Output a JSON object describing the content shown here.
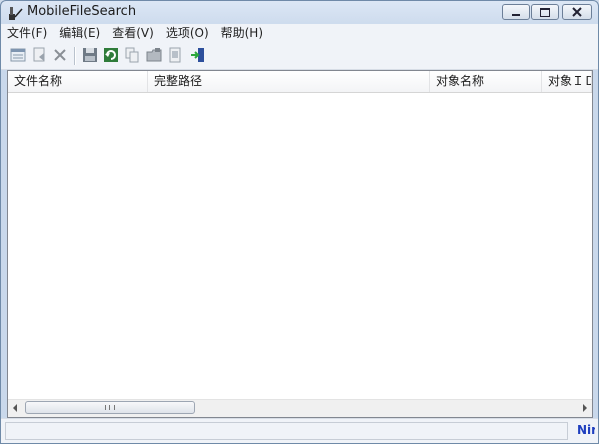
{
  "window": {
    "title": "MobileFileSearch"
  },
  "menu": [
    "文件(F)",
    "编辑(E)",
    "查看(V)",
    "选项(O)",
    "帮助(H)"
  ],
  "toolbar_icons": [
    "properties-icon",
    "open-icon",
    "delete-icon",
    "save-icon",
    "refresh-icon",
    "copy-icon",
    "folder-icon",
    "report-icon",
    "exit-icon"
  ],
  "list": {
    "columns": [
      "文件名称",
      "完整路径",
      "对象名称",
      "对象ＩＤ"
    ]
  },
  "status": {
    "link_text": "NirSoft"
  },
  "colors": {
    "accent": "#1f3fbf",
    "window_bg": "#c9d8eb"
  }
}
